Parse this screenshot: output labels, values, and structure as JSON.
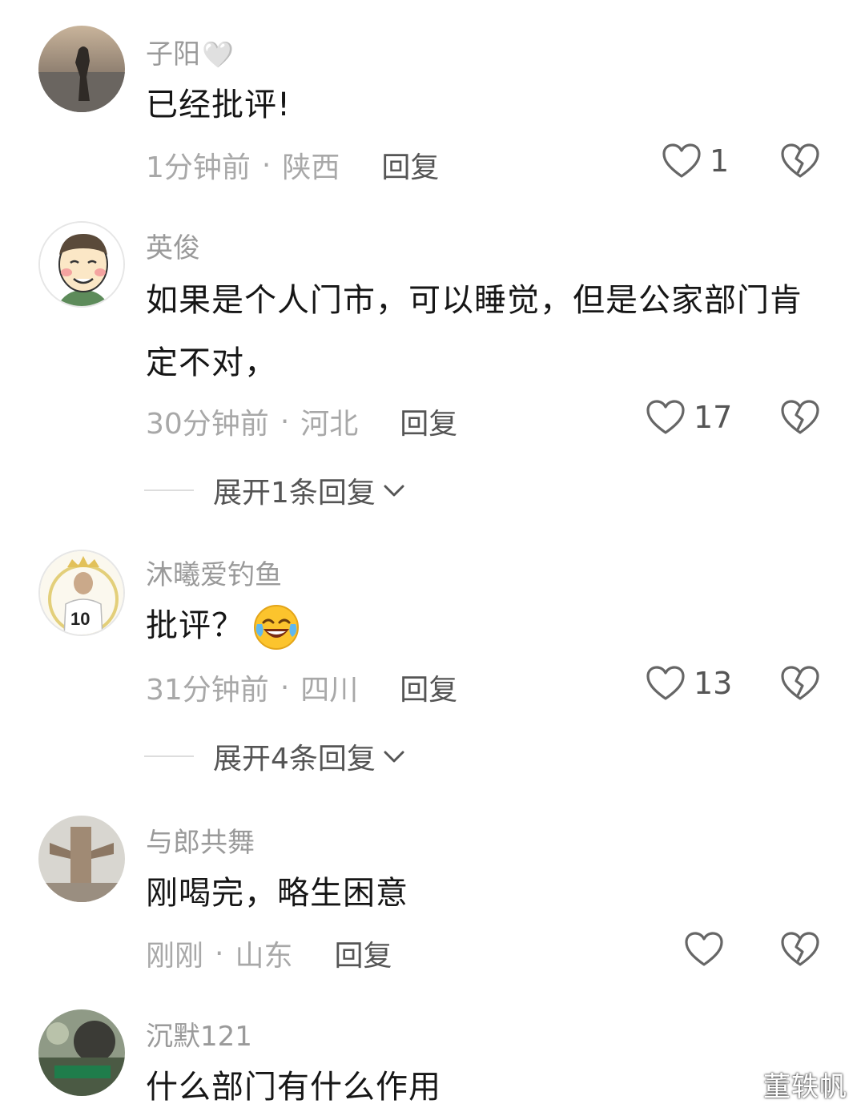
{
  "comments": [
    {
      "username": "子阳",
      "username_suffix": "🤍",
      "text": "已经批评!",
      "time": "1分钟前",
      "location": "陕西",
      "reply_label": "回复",
      "likes": "1"
    },
    {
      "username": "英俊",
      "text": "如果是个人门市，可以睡觉，但是公家部门肯定不对，",
      "time": "30分钟前",
      "location": "河北",
      "reply_label": "回复",
      "likes": "17",
      "expand_label": "展开1条回复"
    },
    {
      "username": "沐曦爱钓鱼",
      "text": "批评？",
      "time": "31分钟前",
      "location": "四川",
      "reply_label": "回复",
      "likes": "13",
      "expand_label": "展开4条回复"
    },
    {
      "username": "与郎共舞",
      "text": "刚喝完，略生困意",
      "time": "刚刚",
      "location": "山东",
      "reply_label": "回复",
      "likes": ""
    },
    {
      "username": "沉默121",
      "text": "什么部门有什么作用"
    }
  ],
  "meta_separator": "·",
  "watermark": "董轶帆",
  "icons": {
    "like": "heart-outline-icon",
    "dislike": "broken-heart-icon",
    "expand": "chevron-down-icon",
    "emoji": "laughing-crying-emoji"
  },
  "colors": {
    "username": "#9a9a9a",
    "text": "#161616",
    "meta": "#a8a8a8",
    "reply": "#555555"
  }
}
